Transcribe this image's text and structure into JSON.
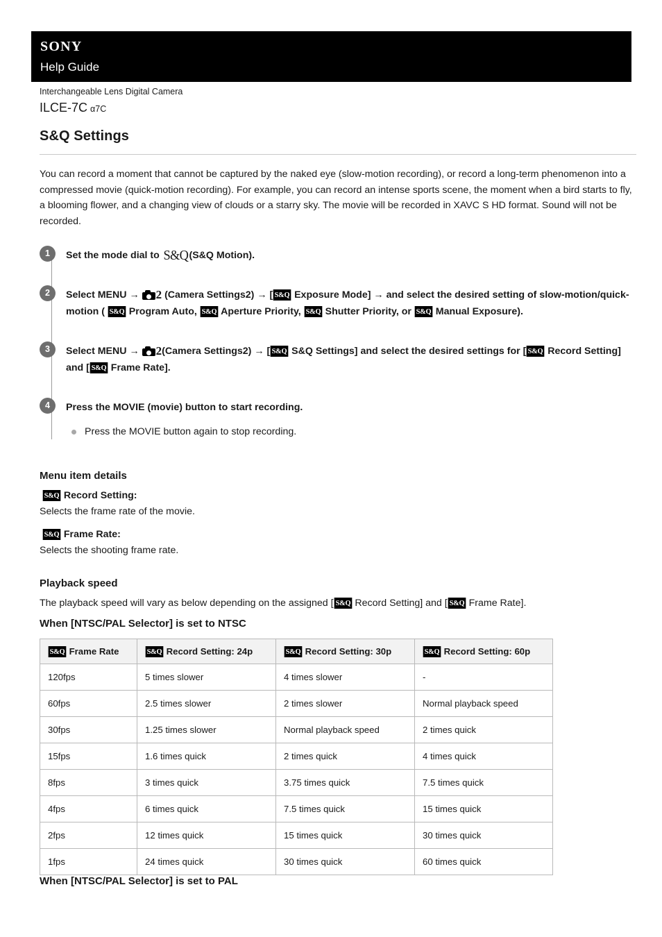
{
  "header": {
    "brand": "SONY",
    "guide_title": "Help Guide"
  },
  "product": {
    "category": "Interchangeable Lens Digital Camera",
    "model": "ILCE-7C",
    "model_alt": "α7C"
  },
  "page": {
    "title": "S&Q Settings",
    "intro": "You can record a moment that cannot be captured by the naked eye (slow-motion recording), or record a long-term phenomenon into a compressed movie (quick-motion recording). For example, you can record an intense sports scene, the moment when a bird starts to fly, a blooming flower, and a changing view of clouds or a starry sky.\nThe movie will be recorded in XAVC S HD format. Sound will not be recorded."
  },
  "icons": {
    "sq_badge_label": "S&Q",
    "sq_glyph_label": "S&Q",
    "camera_icon": "camera-settings-icon",
    "camera_number": "2",
    "arrow": "→"
  },
  "steps": [
    {
      "num": "1",
      "parts": {
        "a": "Set the mode dial to",
        "b": "(S&Q Motion)."
      }
    },
    {
      "num": "2",
      "parts": {
        "a": "Select MENU",
        "b": "(Camera Settings2)",
        "c": "[",
        "d": "Exposure Mode]",
        "e": "and select the desired setting of slow-motion/quick-motion (",
        "f": "Program Auto,",
        "g": "Aperture Priority,",
        "h": "Shutter Priority, or",
        "i": "Manual Exposure)."
      }
    },
    {
      "num": "3",
      "parts": {
        "a": "Select MENU",
        "b": "(Camera Settings2)",
        "c": "[",
        "d": "S&Q Settings] and select the desired settings for [",
        "e": "Record Setting] and [",
        "f": "Frame Rate]."
      }
    },
    {
      "num": "4",
      "parts": {
        "a": "Press the MOVIE (movie) button to start recording."
      },
      "substep": "Press the MOVIE button again to stop recording."
    }
  ],
  "menu_details": {
    "heading": "Menu item details",
    "items": [
      {
        "label": "Record Setting:",
        "desc": "Selects the frame rate of the movie."
      },
      {
        "label": "Frame Rate:",
        "desc": "Selects the shooting frame rate."
      }
    ]
  },
  "playback": {
    "heading": "Playback speed",
    "lead_a": "The playback speed will vary as below depending on the assigned [",
    "lead_b": "Record Setting] and [",
    "lead_c": "Frame Rate].",
    "ntsc_heading": "When [NTSC/PAL Selector] is set to NTSC",
    "pal_heading": "When [NTSC/PAL Selector] is set to PAL"
  },
  "chart_data": {
    "type": "table",
    "title": "When [NTSC/PAL Selector] is set to NTSC",
    "columns": [
      "Frame Rate",
      "Record Setting: 24p",
      "Record Setting: 30p",
      "Record Setting: 60p"
    ],
    "rows": [
      [
        "120fps",
        "5 times slower",
        "4 times slower",
        "-"
      ],
      [
        "60fps",
        "2.5 times slower",
        "2 times slower",
        "Normal playback speed"
      ],
      [
        "30fps",
        "1.25 times slower",
        "Normal playback speed",
        "2 times quick"
      ],
      [
        "15fps",
        "1.6 times quick",
        "2 times quick",
        "4 times quick"
      ],
      [
        "8fps",
        "3 times quick",
        "3.75 times quick",
        "7.5 times quick"
      ],
      [
        "4fps",
        "6 times quick",
        "7.5 times quick",
        "15 times quick"
      ],
      [
        "2fps",
        "12 times quick",
        "15 times quick",
        "30 times quick"
      ],
      [
        "1fps",
        "24 times quick",
        "30 times quick",
        "60 times quick"
      ]
    ]
  },
  "colors": {
    "header_bg": "#000000",
    "step_circle": "#6e6e6e",
    "table_header_bg": "#f2f2f2",
    "table_border": "#b9b9b9",
    "rule": "#c9c9c9"
  }
}
